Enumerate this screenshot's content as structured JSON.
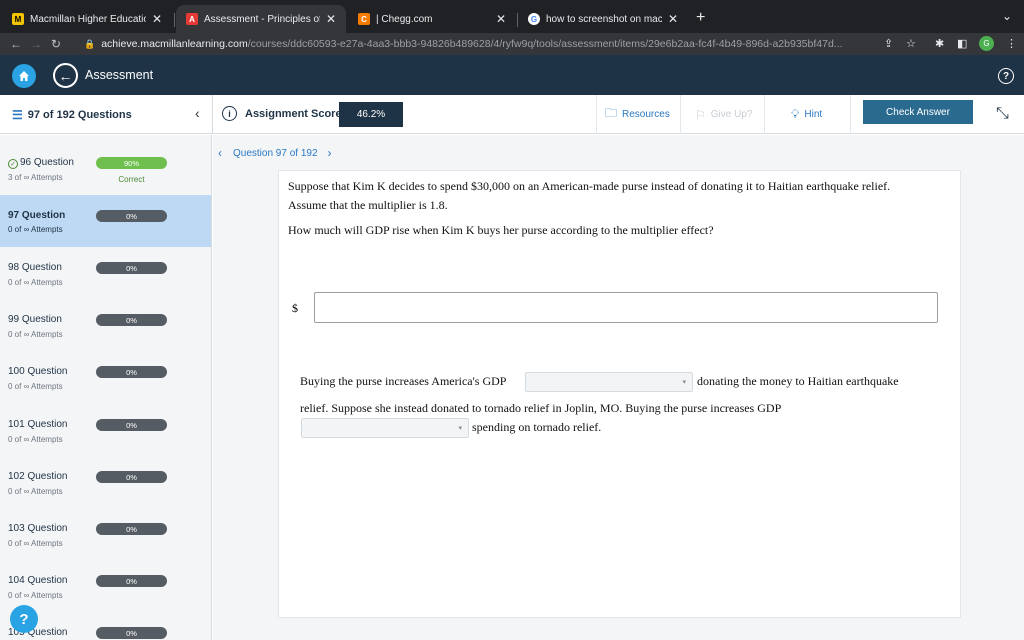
{
  "browser": {
    "tabs": [
      {
        "title": "Macmillan Higher Education",
        "favicon": "macmillan-icon"
      },
      {
        "title": "Assessment - Principles of Ma",
        "favicon": "achieve-icon",
        "active": true
      },
      {
        "title": "| Chegg.com",
        "favicon": "chegg-icon"
      },
      {
        "title": "how to screenshot on mac - Go",
        "favicon": "google-icon"
      }
    ],
    "url_host": "achieve.macmillanlearning.com",
    "url_path": "/courses/ddc60593-e27a-4aa3-bbb3-94826b489628/4/ryfw9q/tools/assessment/items/29e6b2aa-fc4f-4b49-896d-a2b935bf47d...",
    "profile_initial": "G"
  },
  "app": {
    "title": "Assessment"
  },
  "subbar": {
    "question_count": "97 of 192 Questions",
    "score_label": "Assignment Score:",
    "score_value": "46.2%",
    "resources": "Resources",
    "give_up": "Give Up?",
    "hint": "Hint",
    "check_answer": "Check Answer"
  },
  "sidebar": {
    "items": [
      {
        "name": "96 Question",
        "attempts": "3 of ∞ Attempts",
        "progress": "90%",
        "status": "Correct",
        "correct": true
      },
      {
        "name": "97 Question",
        "attempts": "0 of ∞ Attempts",
        "progress": "0%",
        "active": true
      },
      {
        "name": "98 Question",
        "attempts": "0 of ∞ Attempts",
        "progress": "0%"
      },
      {
        "name": "99 Question",
        "attempts": "0 of ∞ Attempts",
        "progress": "0%"
      },
      {
        "name": "100 Question",
        "attempts": "0 of ∞ Attempts",
        "progress": "0%"
      },
      {
        "name": "101 Question",
        "attempts": "0 of ∞ Attempts",
        "progress": "0%"
      },
      {
        "name": "102 Question",
        "attempts": "0 of ∞ Attempts",
        "progress": "0%"
      },
      {
        "name": "103 Question",
        "attempts": "0 of ∞ Attempts",
        "progress": "0%"
      },
      {
        "name": "104 Question",
        "attempts": "0 of ∞ Attempts",
        "progress": "0%"
      },
      {
        "name": "105 Question",
        "attempts": "",
        "progress": "0%"
      }
    ],
    "help": "?"
  },
  "main": {
    "question_nav": "Question 97 of 192",
    "prompt_line1": "Suppose that Kim K decides to spend $30,000 on an American-made purse instead of donating it to Haitian earthquake relief.",
    "prompt_line2": "Assume that the multiplier is 1.8.",
    "question": "How much will GDP rise when Kim K buys her purse according to the multiplier effect?",
    "dollar_sign": "$",
    "answer_value": "",
    "fill_part1": "Buying the purse increases America's GDP",
    "fill_part2": "donating the money to Haitian earthquake",
    "fill_part3": "relief. Suppose she instead donated to tornado relief in Joplin, MO. Buying the purse increases GDP",
    "fill_part4": "spending on tornado relief.",
    "select1_value": "",
    "select2_value": ""
  },
  "colors": {
    "appbar": "#1f3346",
    "accent": "#2a78c2",
    "active_row": "#bed9f3",
    "correct_green": "#6fbf4e"
  }
}
